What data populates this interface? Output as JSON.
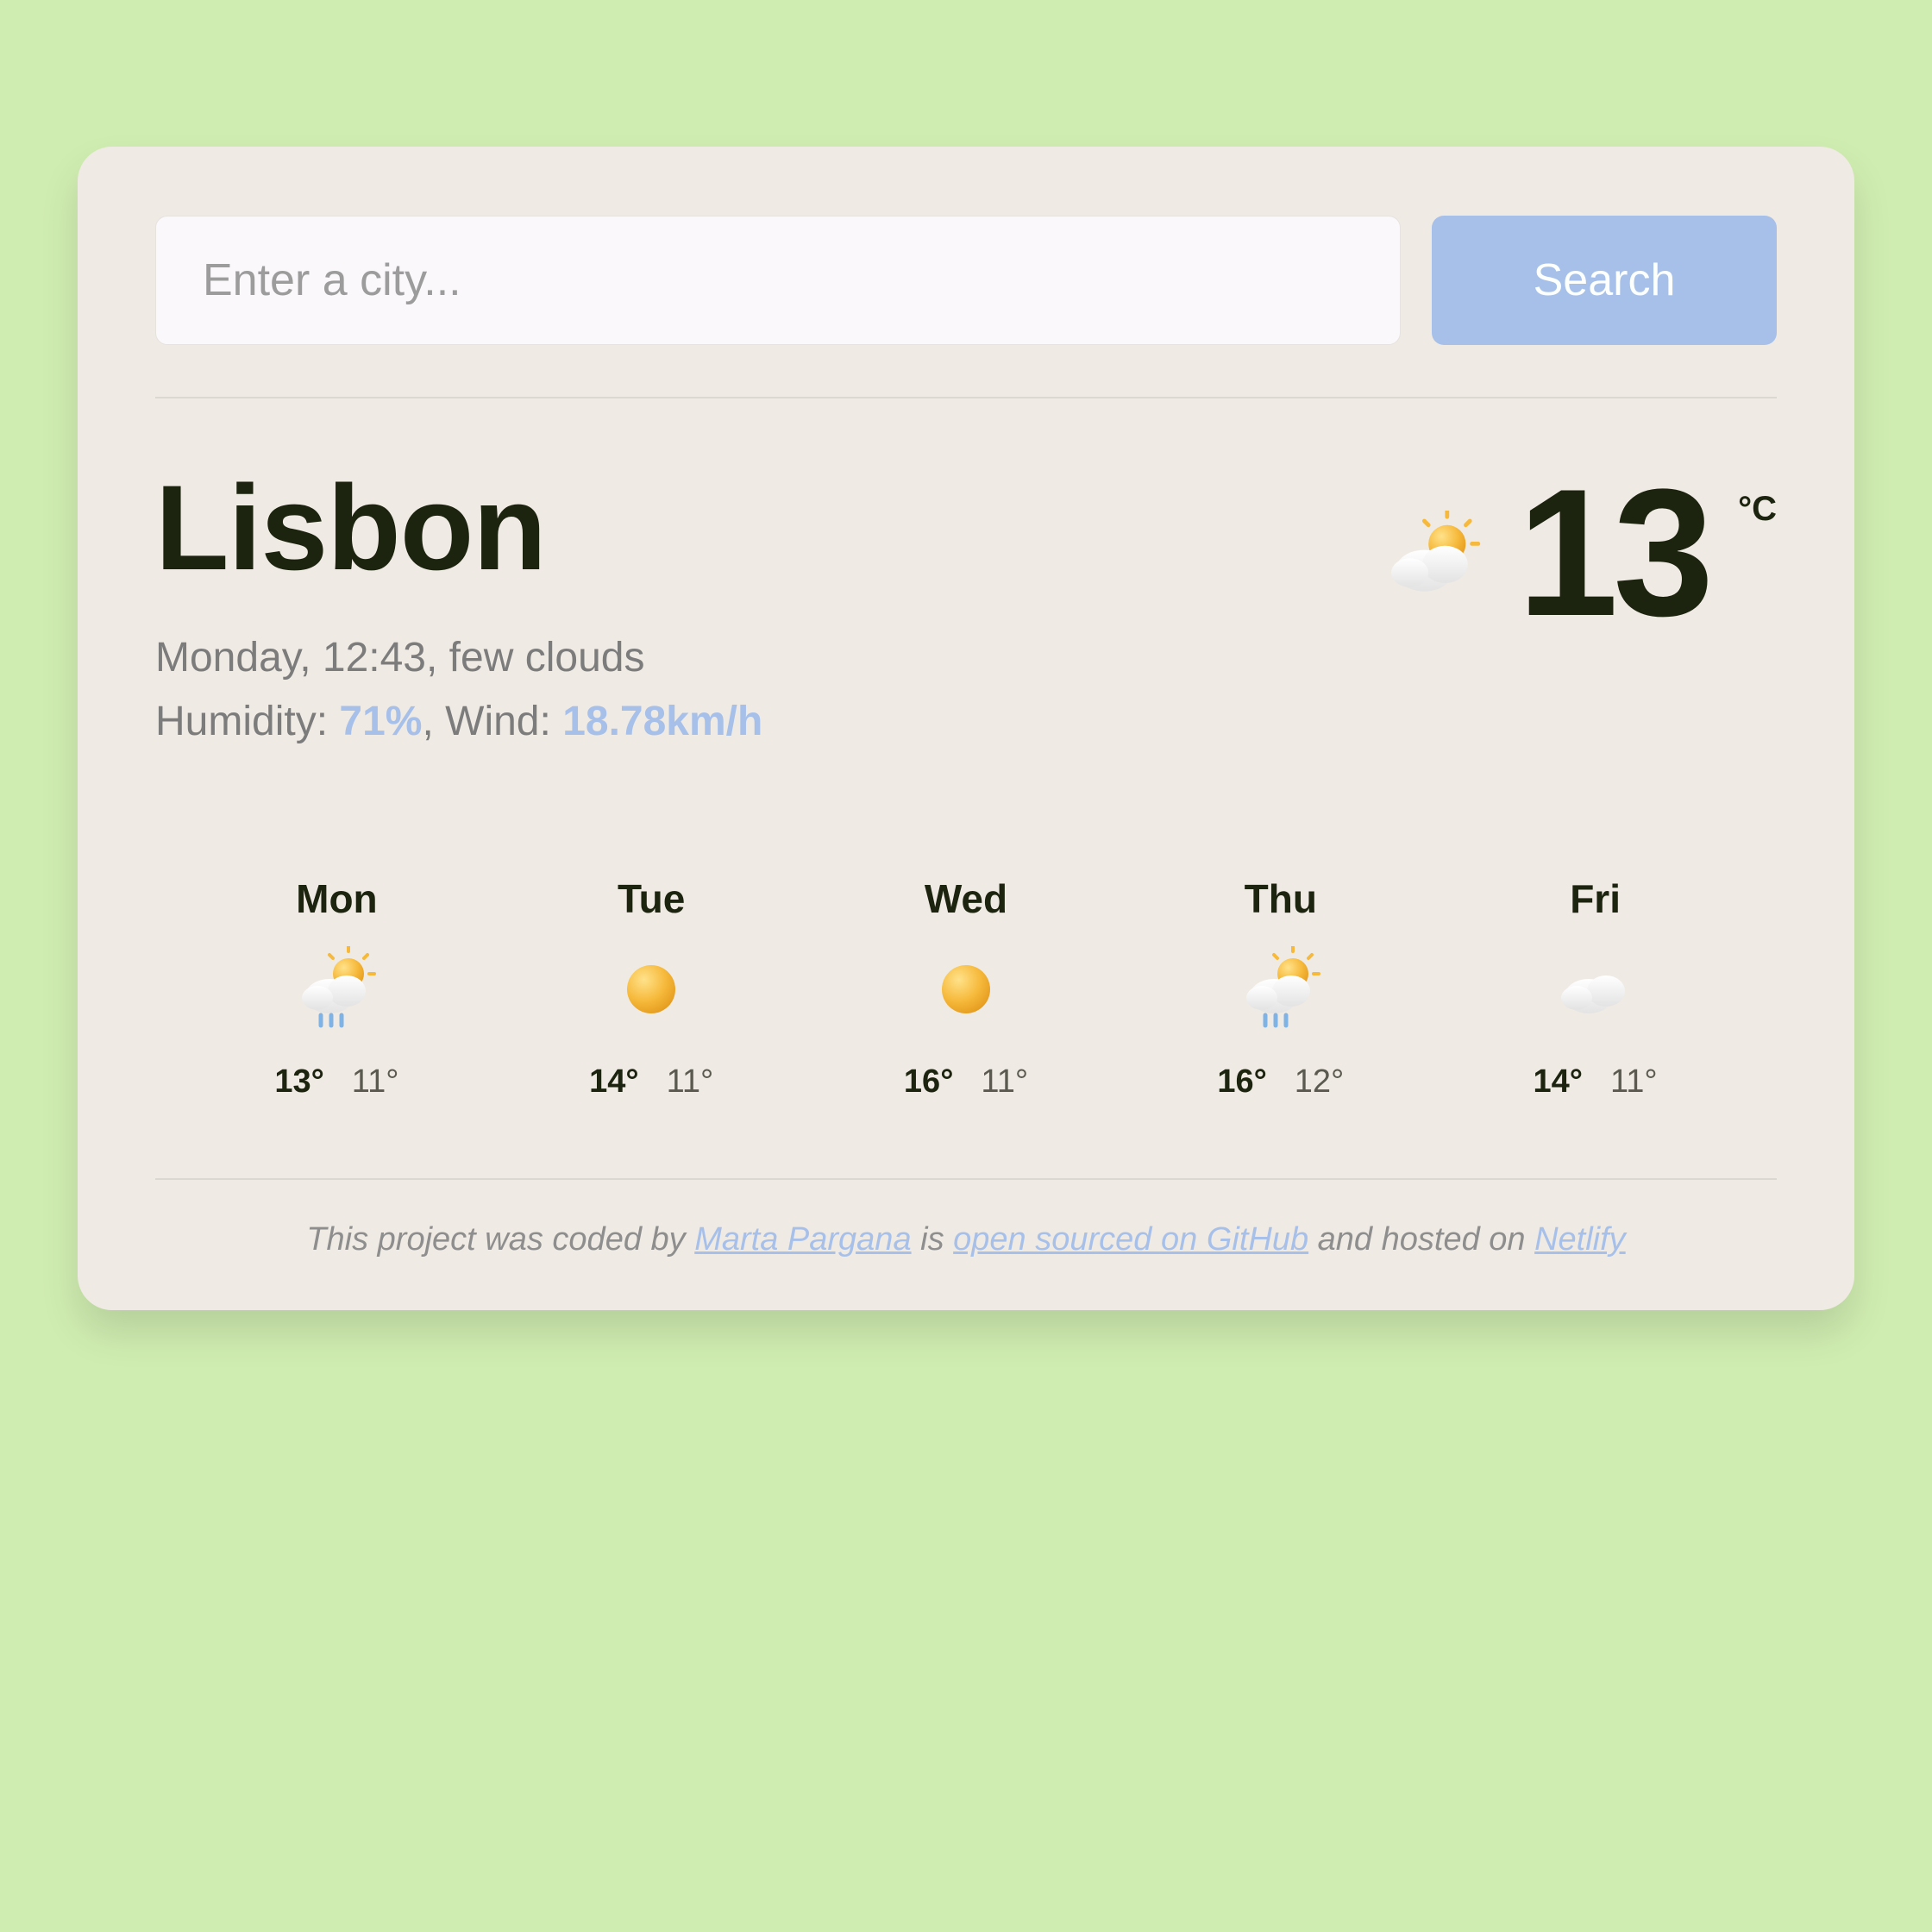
{
  "search": {
    "placeholder": "Enter a city...",
    "button_label": "Search"
  },
  "current": {
    "city": "Lisbon",
    "datetime": "Monday, 12:43",
    "condition": "few clouds",
    "humidity_label": "Humidity:",
    "humidity_value": "71%",
    "wind_label": "Wind:",
    "wind_value": "18.78km/h",
    "temp": "13",
    "unit": "°C",
    "icon": "cloud-sun"
  },
  "forecast": [
    {
      "day": "Mon",
      "icon": "cloud-sun-rain",
      "hi": "13°",
      "lo": "11°"
    },
    {
      "day": "Tue",
      "icon": "sun",
      "hi": "14°",
      "lo": "11°"
    },
    {
      "day": "Wed",
      "icon": "sun",
      "hi": "16°",
      "lo": "11°"
    },
    {
      "day": "Thu",
      "icon": "cloud-sun-rain",
      "hi": "16°",
      "lo": "12°"
    },
    {
      "day": "Fri",
      "icon": "cloud",
      "hi": "14°",
      "lo": "11°"
    }
  ],
  "footer": {
    "pre": "This project was coded by ",
    "author": "Marta Pargana",
    "mid1": " is ",
    "link_source": "open sourced on GitHub",
    "mid2": " and hosted on ",
    "host": "Netlify"
  }
}
